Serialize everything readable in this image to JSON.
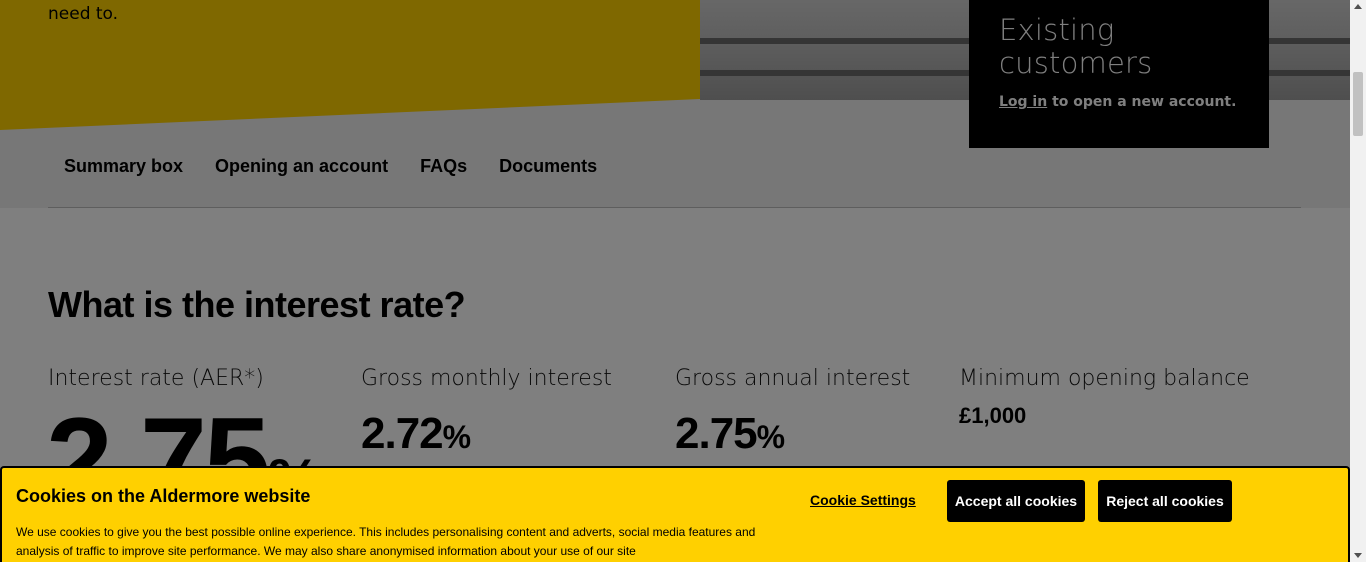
{
  "hero": {
    "intro_tail": "need to."
  },
  "existing": {
    "title": "Existing customers",
    "login_link": "Log in",
    "login_suffix": "to open a new account."
  },
  "tabs": [
    {
      "label": "Summary box"
    },
    {
      "label": "Opening an account"
    },
    {
      "label": "FAQs"
    },
    {
      "label": "Documents"
    }
  ],
  "rates": {
    "heading": "What is the interest rate?",
    "aer_label": "Interest rate (AER*)",
    "aer_value": "2.75",
    "aer_unit": "%",
    "monthly_label": "Gross monthly interest",
    "monthly_value": "2.72",
    "monthly_unit": "%",
    "annual_label": "Gross annual interest",
    "annual_value": "2.75",
    "annual_unit": "%",
    "min_label": "Minimum opening balance",
    "min_value": "£1,000"
  },
  "cookie": {
    "title": "Cookies on the Aldermore website",
    "body": "We use cookies to give you the best possible online experience. This includes personalising content and adverts, social media features and analysis of traffic to improve site performance. We may also share anonymised information about your use of our site",
    "settings_label": "Cookie Settings",
    "accept_label": "Accept all cookies",
    "reject_label": "Reject all cookies"
  },
  "colors": {
    "brand_yellow": "#ffd000",
    "black": "#000000",
    "overlay": "rgba(0,0,0,0.5)"
  }
}
